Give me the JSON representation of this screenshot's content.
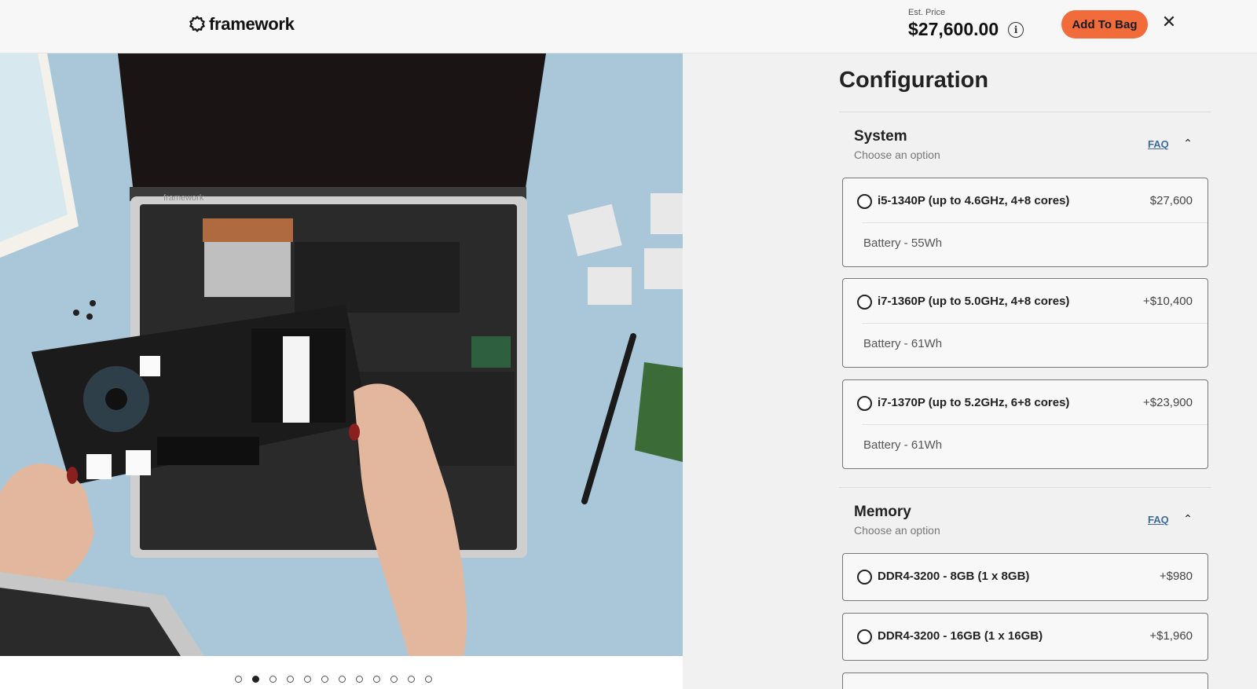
{
  "header": {
    "brand": "framework",
    "est_label": "Est. Price",
    "est_value": "$27,600.00",
    "add_to_bag": "Add To Bag"
  },
  "gallery": {
    "image_alt": "Framework laptop mainboard being installed",
    "logo_on_device": "framework",
    "active_dot": 2,
    "dots": 12
  },
  "config": {
    "title": "Configuration",
    "sections": [
      {
        "title": "System",
        "subtitle": "Choose an option",
        "faq": "FAQ",
        "options": [
          {
            "label": "i5-1340P (up to 4.6GHz, 4+8 cores)",
            "price": "$27,600",
            "detail": "Battery - 55Wh"
          },
          {
            "label": "i7-1360P (up to 5.0GHz, 4+8 cores)",
            "price": "+$10,400",
            "detail": "Battery - 61Wh"
          },
          {
            "label": "i7-1370P (up to 5.2GHz, 6+8 cores)",
            "price": "+$23,900",
            "detail": "Battery - 61Wh"
          }
        ]
      },
      {
        "title": "Memory",
        "subtitle": "Choose an option",
        "faq": "FAQ",
        "options": [
          {
            "label": "DDR4-3200 - 8GB (1 x 8GB)",
            "price": "+$980"
          },
          {
            "label": "DDR4-3200 - 16GB (1 x 16GB)",
            "price": "+$1,960"
          }
        ]
      }
    ]
  },
  "colors": {
    "accent": "#f26b3a",
    "link": "#3d6aa0",
    "photo_bg": "#a9c7d8"
  }
}
